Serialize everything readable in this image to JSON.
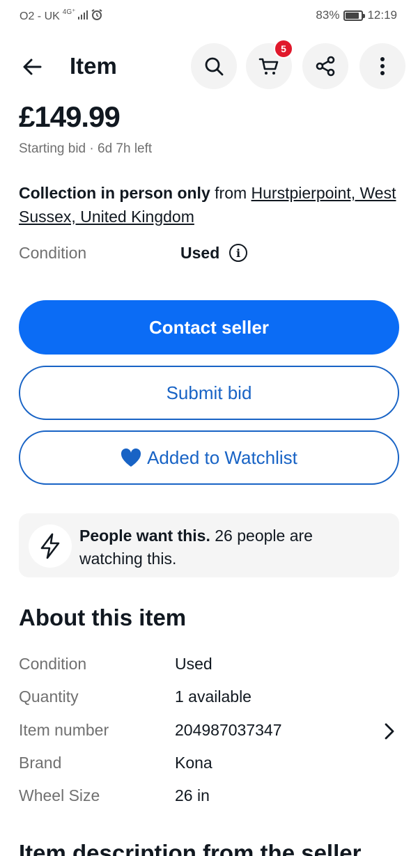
{
  "status_bar": {
    "carrier": "O2 - UK",
    "network": "4G⁺",
    "battery": "83%",
    "battery_level": 0.83,
    "time": "12:19"
  },
  "header": {
    "title": "Item",
    "cart_count": "5",
    "icons": [
      "back-arrow-icon",
      "search-icon",
      "cart-icon",
      "share-icon",
      "more-icon"
    ]
  },
  "listing": {
    "price": "£149.99",
    "subtitle": "Starting bid · 6d 7h left",
    "collection_bold": "Collection in person only",
    "collection_from": " from ",
    "collection_location": "Hurstpierpoint, West Sussex, United Kingdom",
    "condition_label": "Condition",
    "condition_value": "Used"
  },
  "actions": {
    "contact": "Contact seller",
    "bid": "Submit bid",
    "watchlist": "Added to Watchlist"
  },
  "watch_card": {
    "bold": "People want this.",
    "text": " 26 people are watching this."
  },
  "about": {
    "title": "About this item",
    "rows": [
      {
        "key": "Condition",
        "value": "Used"
      },
      {
        "key": "Quantity",
        "value": "1 available"
      },
      {
        "key": "Item number",
        "value": "204987037347"
      },
      {
        "key": "Brand",
        "value": "Kona"
      },
      {
        "key": "Wheel Size",
        "value": "26 in"
      }
    ]
  },
  "description": {
    "title": "Item description from the seller"
  },
  "colors": {
    "primary": "#0b6cf5",
    "outline": "#1863c5",
    "badge": "#e0182b",
    "muted": "#707070"
  }
}
